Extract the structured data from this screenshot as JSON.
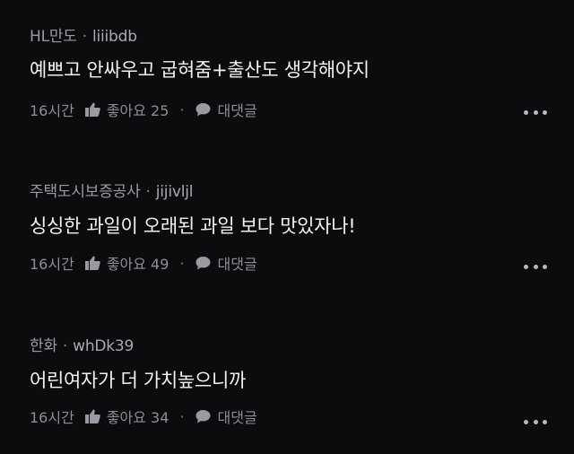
{
  "comments": [
    {
      "affiliation": "HL만도",
      "nickname": "liiibdb",
      "text": "예쁘고 안싸우고 굽혀줌+출산도 생각해야지",
      "time": "16시간",
      "like_label": "좋아요 25",
      "reply_label": "대댓글"
    },
    {
      "affiliation": "주택도시보증공사",
      "nickname": "jijivljl",
      "text": "싱싱한 과일이 오래된 과일 보다 맛있자나!",
      "time": "16시간",
      "like_label": "좋아요 49",
      "reply_label": "대댓글"
    },
    {
      "affiliation": "한화",
      "nickname": "whDk39",
      "text": "어린여자가 더 가치높으니까",
      "time": "16시간",
      "like_label": "좋아요 34",
      "reply_label": "대댓글"
    }
  ],
  "separator": "·",
  "icons": {
    "like": "thumbs-up-icon",
    "reply": "speech-bubble-icon",
    "more": "more-dots-icon"
  },
  "colors": {
    "background": "#0c0c0e",
    "text": "#f2f2f4",
    "muted": "#8e8e96"
  }
}
